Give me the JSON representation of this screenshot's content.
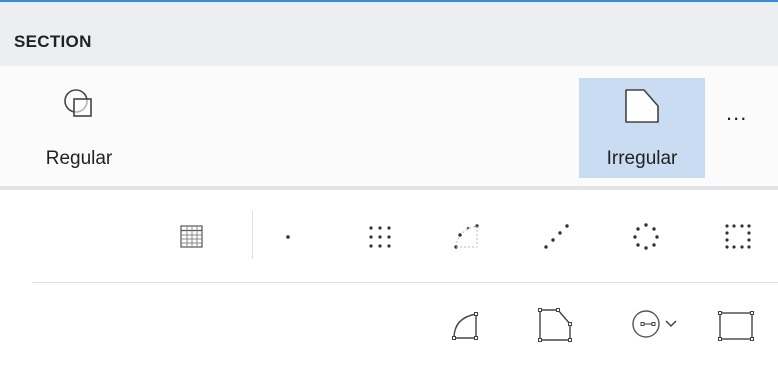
{
  "section": {
    "title": "SECTION"
  },
  "ribbon": {
    "regular_label": "Regular",
    "irregular_label": "Irregular",
    "more_label": "..."
  },
  "tools": {
    "row1": [
      "table-icon",
      "point-icon",
      "grid-points-icon",
      "arc-points-icon",
      "line-points-icon",
      "circle-points-icon",
      "rectangle-points-icon"
    ],
    "row2": [
      "quarter-circle-icon",
      "chamfer-polygon-icon",
      "circle-radius-icon",
      "rectangle-icon"
    ]
  },
  "colors": {
    "accent_line": "#2f8fd8",
    "header_bg": "#eceef1",
    "selected_bg": "#c9dcf1",
    "icon_stroke": "#444444"
  }
}
